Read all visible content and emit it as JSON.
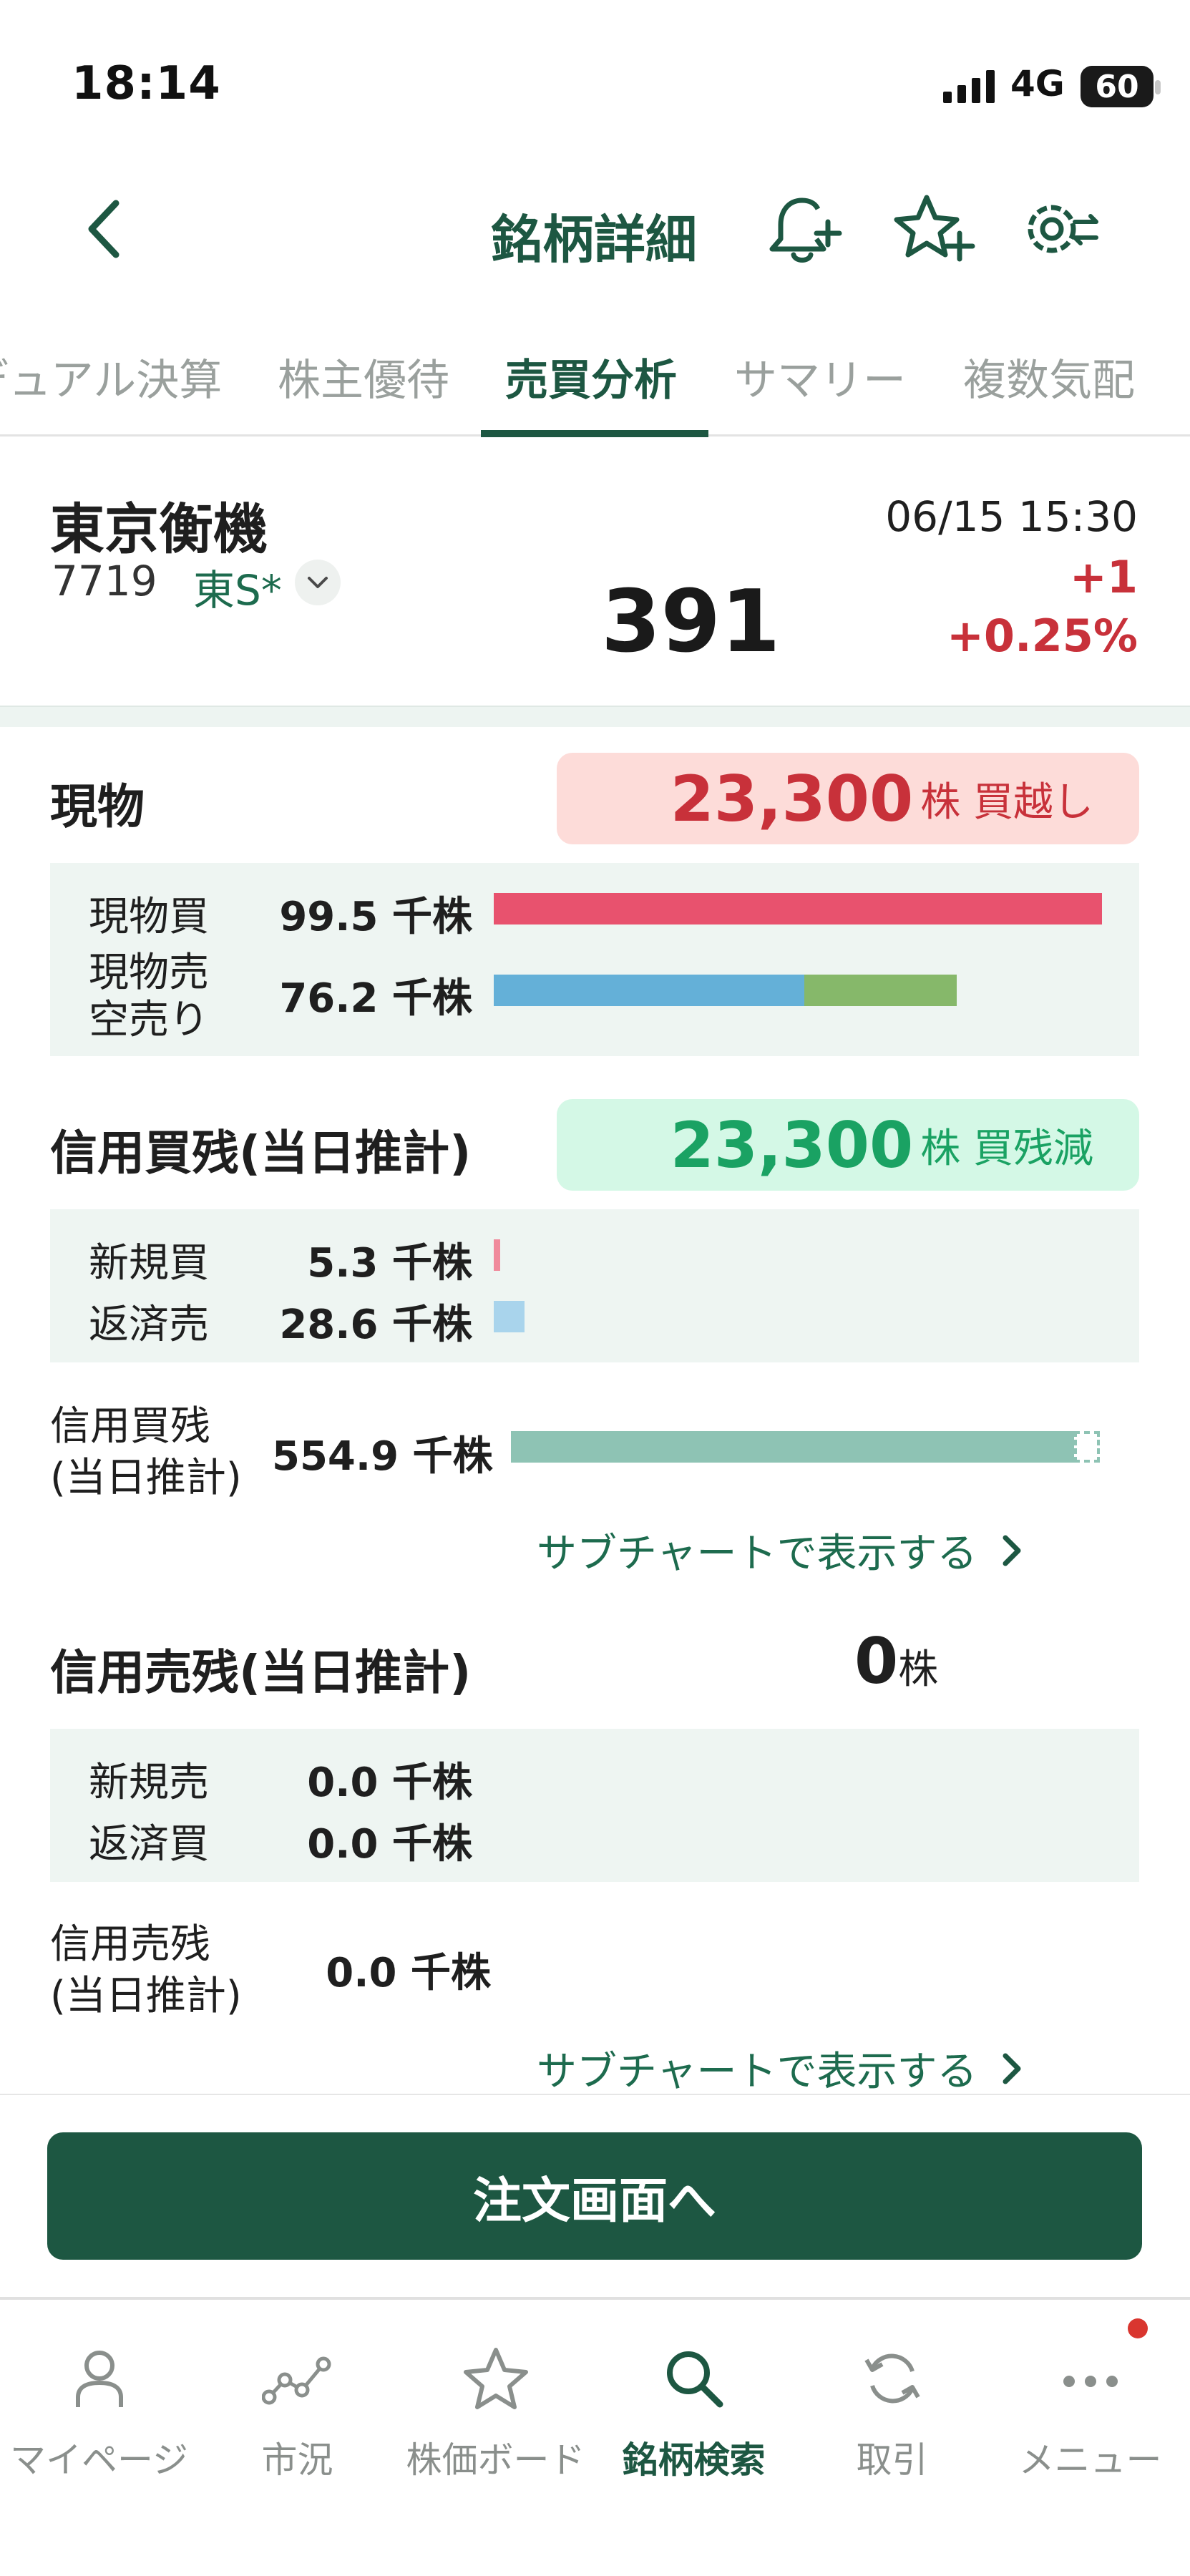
{
  "status_bar": {
    "time": "18:14",
    "network": "4G",
    "battery": "60"
  },
  "header": {
    "title": "銘柄詳細"
  },
  "tabs": [
    {
      "label": "デュアル決算",
      "active": false
    },
    {
      "label": "株主優待",
      "active": false
    },
    {
      "label": "売買分析",
      "active": true
    },
    {
      "label": "サマリー",
      "active": false
    },
    {
      "label": "複数気配",
      "active": false
    }
  ],
  "stock": {
    "name": "東京衡機",
    "code": "7719",
    "market": "東S*",
    "timestamp": "06/15 15:30",
    "price": "391",
    "change": "+1",
    "change_pct": "+0.25%"
  },
  "genbutsu": {
    "title": "現物",
    "badge_value": "23,300",
    "badge_unit": "株 買越し",
    "rows": [
      {
        "label": "現物買",
        "value": "99.5 千株"
      },
      {
        "label": "現物売",
        "label2": "空売り",
        "value": "76.2 千株"
      }
    ],
    "buy_fraction": 1.0,
    "sell_fraction": 0.51,
    "short_fraction": 0.25
  },
  "shinyo_kai": {
    "title": "信用買残(当日推計)",
    "badge_value": "23,300",
    "badge_unit": "株 買残減",
    "rows": [
      {
        "label": "新規買",
        "value": "5.3 千株"
      },
      {
        "label": "返済売",
        "value": "28.6 千株"
      }
    ],
    "new_buy_fraction": 0.01,
    "repay_sell_fraction": 0.05,
    "balance_label_1": "信用買残",
    "balance_label_2": "(当日推計)",
    "balance_value": "554.9 千株",
    "balance_fraction": 0.96,
    "subchart_link": "サブチャートで表示する"
  },
  "shinyo_uri": {
    "title": "信用売残(当日推計)",
    "total_value": "0",
    "total_unit": "株",
    "rows": [
      {
        "label": "新規売",
        "value": "0.0 千株"
      },
      {
        "label": "返済買",
        "value": "0.0 千株"
      }
    ],
    "balance_label_1": "信用売残",
    "balance_label_2": "(当日推計)",
    "balance_value": "0.0 千株",
    "subchart_link": "サブチャートで表示する"
  },
  "order_button": "注文画面へ",
  "bottom_nav": [
    {
      "label": "マイページ",
      "icon": "person-icon",
      "active": false
    },
    {
      "label": "市況",
      "icon": "market-graph-icon",
      "active": false
    },
    {
      "label": "株価ボード",
      "icon": "star-icon",
      "active": false
    },
    {
      "label": "銘柄検索",
      "icon": "search-icon",
      "active": true
    },
    {
      "label": "取引",
      "icon": "refresh-icon",
      "active": false
    },
    {
      "label": "メニュー",
      "icon": "more-dots-icon",
      "active": false
    }
  ],
  "colors": {
    "brand_green": "#1d5742",
    "up_red": "#c8313a",
    "buy_bar": "#e8526e",
    "sell_bar": "#64b0d8",
    "short_bar": "#86b86a",
    "new_buy_bar": "#f08a9c",
    "repay_sell_bar": "#a9d4ec",
    "balance_bar": "#8ec3b4",
    "decrease_green": "#1aa263"
  }
}
